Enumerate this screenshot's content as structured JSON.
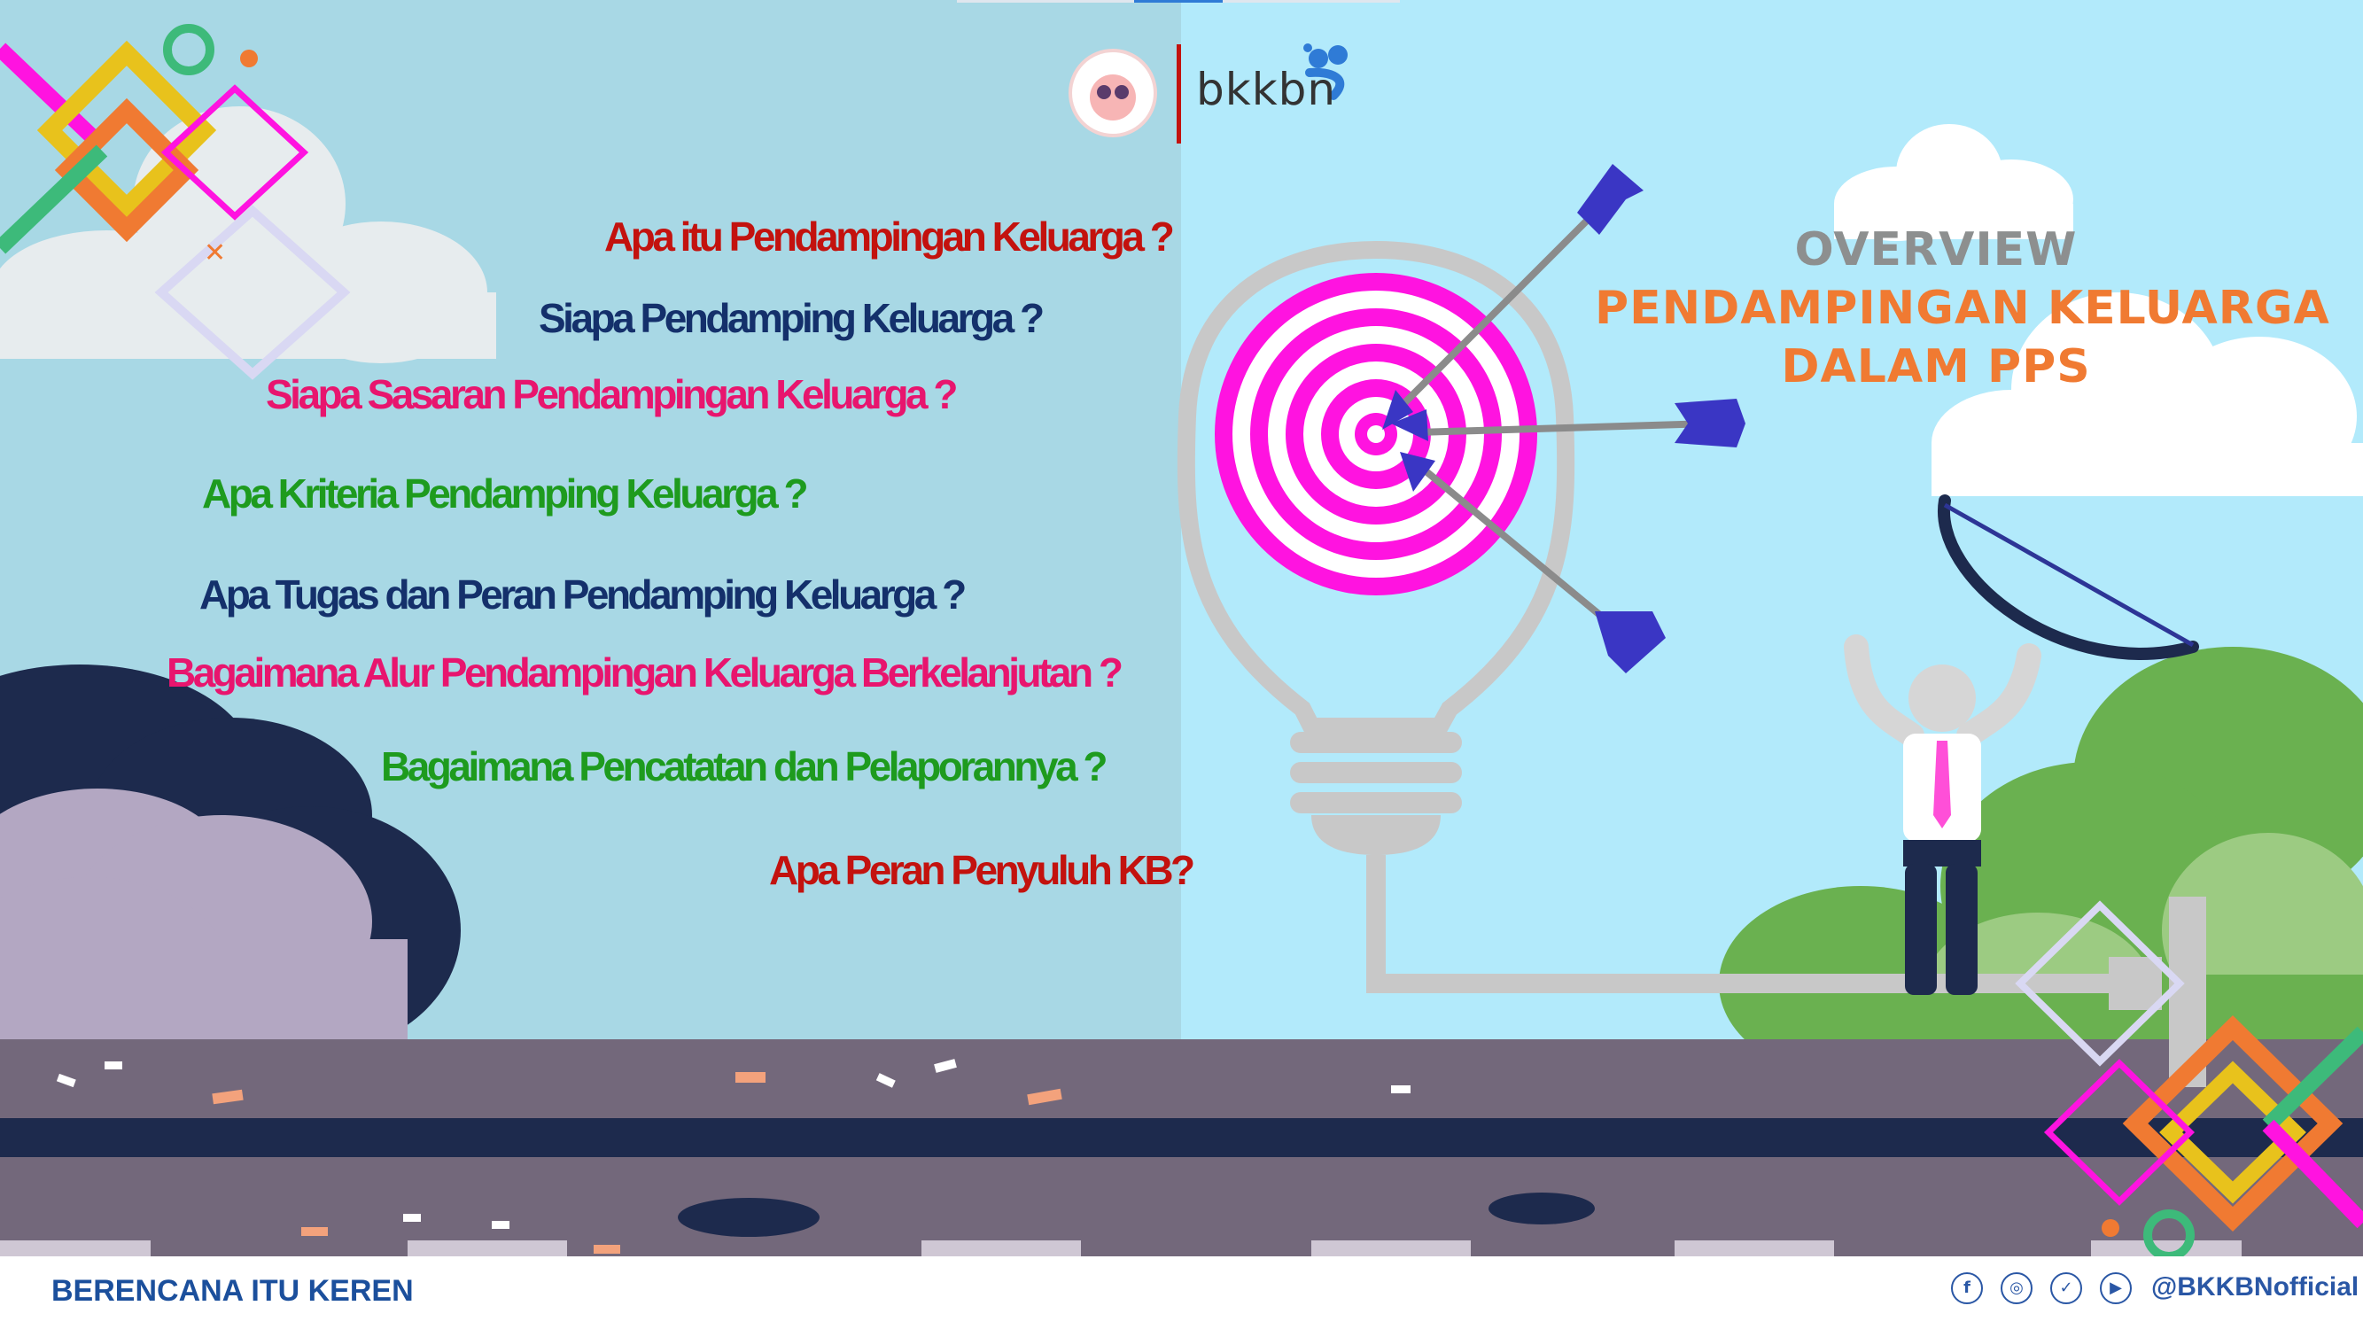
{
  "branding": {
    "logo_text": "bkkbn",
    "slogan": "BERENCANA ITU KEREN",
    "social_handle": "@BKKBNofficial",
    "social_icons": [
      "facebook-icon",
      "instagram-icon",
      "twitter-icon",
      "youtube-icon"
    ]
  },
  "overview": {
    "line1": "OVERVIEW",
    "line2": "PENDAMPINGAN KELUARGA",
    "line3": "DALAM PPS"
  },
  "questions": [
    {
      "text": "Apa itu Pendampingan Keluarga ?",
      "color": "#c3120e"
    },
    {
      "text": "Siapa Pendamping Keluarga ?",
      "color": "#14306b"
    },
    {
      "text": "Siapa Sasaran Pendampingan Keluarga ?",
      "color": "#e8156e"
    },
    {
      "text": "Apa Kriteria Pendamping Keluarga ?",
      "color": "#1e9b1e"
    },
    {
      "text": "Apa Tugas dan Peran Pendamping Keluarga ?",
      "color": "#14306b"
    },
    {
      "text": "Bagaimana Alur Pendampingan Keluarga Berkelanjutan ?",
      "color": "#e8156e"
    },
    {
      "text": "Bagaimana Pencatatan dan Pelaporannya ?",
      "color": "#1e9b1e"
    },
    {
      "text": "Apa Peran Penyuluh KB?",
      "color": "#c3120e"
    }
  ],
  "colors": {
    "sky_left": "#a8d8e5",
    "sky_right": "#b2eafb",
    "overview_gray": "#8d8f8f",
    "overview_orange": "#f07a32",
    "target_magenta": "#ff13e0",
    "arrow_blue": "#3a36c4",
    "slogan_blue": "#1b4f9c"
  }
}
